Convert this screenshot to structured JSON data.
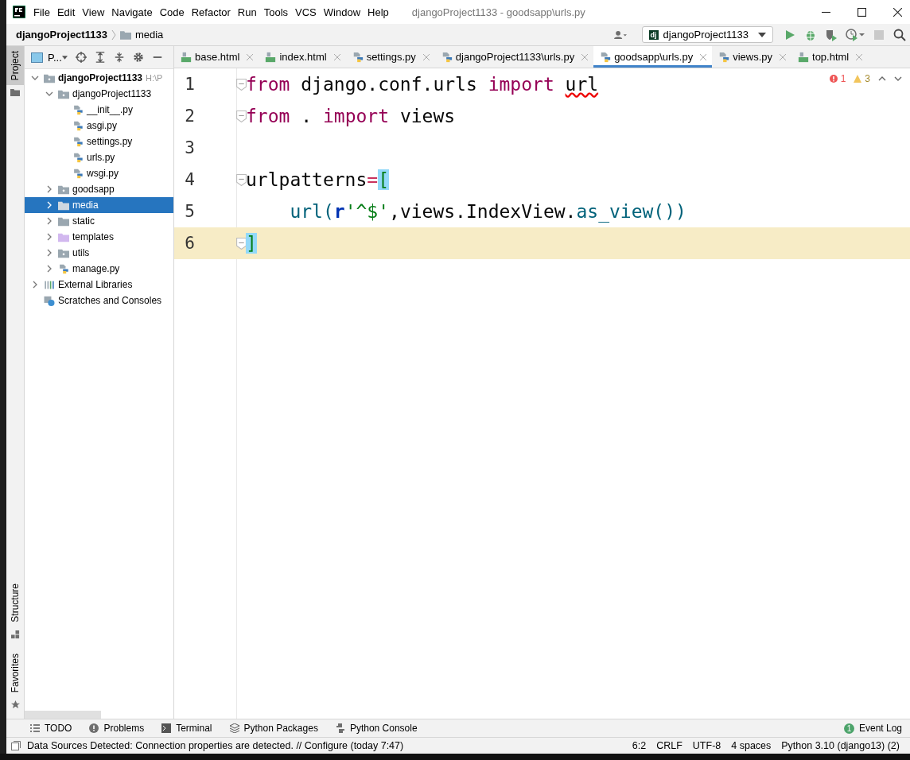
{
  "window": {
    "title": "djangoProject1133 - goodsapp\\urls.py"
  },
  "menu": [
    "File",
    "Edit",
    "View",
    "Navigate",
    "Code",
    "Refactor",
    "Run",
    "Tools",
    "VCS",
    "Window",
    "Help"
  ],
  "breadcrumb": [
    "djangoProject1133",
    "media"
  ],
  "run_config_badge": "dj",
  "run_config": "djangoProject1133",
  "left_stripe": [
    {
      "label": "Project",
      "selected": true
    }
  ],
  "left_stripe_bottom": [
    {
      "label": "Structure",
      "kind": "structure"
    },
    {
      "label": "Favorites",
      "kind": "favorites"
    }
  ],
  "project_panel": {
    "title": "P...",
    "tree": [
      {
        "label": "djangoProject1133",
        "kind": "root",
        "hint": "H:\\P",
        "expanded": true,
        "selected": false,
        "children": [
          {
            "label": "djangoProject1133",
            "kind": "package",
            "expanded": true,
            "selected": false,
            "children": [
              {
                "label": "__init__.py",
                "kind": "python",
                "selected": false
              },
              {
                "label": "asgi.py",
                "kind": "python",
                "selected": false
              },
              {
                "label": "settings.py",
                "kind": "python",
                "selected": false
              },
              {
                "label": "urls.py",
                "kind": "python",
                "selected": false
              },
              {
                "label": "wsgi.py",
                "kind": "python",
                "selected": false
              }
            ]
          },
          {
            "label": "goodsapp",
            "kind": "package",
            "expanded": false,
            "selected": false
          },
          {
            "label": "media",
            "kind": "folder",
            "expanded": false,
            "selected": true
          },
          {
            "label": "static",
            "kind": "folder",
            "expanded": false,
            "selected": false
          },
          {
            "label": "templates",
            "kind": "templates",
            "expanded": false,
            "selected": false
          },
          {
            "label": "utils",
            "kind": "package",
            "expanded": false,
            "selected": false
          },
          {
            "label": "manage.py",
            "kind": "python",
            "expanded": false,
            "selected": false
          }
        ]
      },
      {
        "label": "External Libraries",
        "kind": "libraries",
        "expanded": false,
        "selected": false
      },
      {
        "label": "Scratches and Consoles",
        "kind": "scratches",
        "selected": false
      }
    ]
  },
  "tabs": [
    {
      "label": "base.html",
      "kind": "html",
      "selected": false
    },
    {
      "label": "index.html",
      "kind": "html",
      "selected": false
    },
    {
      "label": "settings.py",
      "kind": "python",
      "selected": false
    },
    {
      "label": "djangoProject1133\\urls.py",
      "kind": "python",
      "selected": false
    },
    {
      "label": "goodsapp\\urls.py",
      "kind": "python",
      "selected": true
    },
    {
      "label": "views.py",
      "kind": "python",
      "selected": false
    },
    {
      "label": "top.html",
      "kind": "html",
      "selected": false
    }
  ],
  "inspections": {
    "errors": "1",
    "warnings": "3"
  },
  "code": [
    {
      "number": "1",
      "current": false,
      "fold": true,
      "tokens": [
        {
          "text": "from",
          "kind": "kw"
        },
        {
          "text": " django.conf.urls ",
          "kind": "plain"
        },
        {
          "text": "import ",
          "kind": "kw"
        },
        {
          "text": "url",
          "kind": "error"
        }
      ]
    },
    {
      "number": "2",
      "current": false,
      "fold": true,
      "tokens": [
        {
          "text": "from",
          "kind": "kw"
        },
        {
          "text": " . ",
          "kind": "plain"
        },
        {
          "text": "import",
          "kind": "kw"
        },
        {
          "text": " views",
          "kind": "plain"
        }
      ]
    },
    {
      "number": "3",
      "current": false,
      "fold": false
    },
    {
      "number": "4",
      "current": false,
      "fold": true,
      "tokens": [
        {
          "text": "urlpatterns",
          "kind": "plain"
        },
        {
          "text": "=",
          "kind": "op"
        },
        {
          "text": "[",
          "kind": "match"
        }
      ]
    },
    {
      "number": "5",
      "current": false,
      "fold": false,
      "tokens": [
        {
          "text": "    url(",
          "kind": "func"
        },
        {
          "text": "r",
          "kind": "prefix"
        },
        {
          "text": "'^$'",
          "kind": "str"
        },
        {
          "text": ",views.IndexView.",
          "kind": "plain"
        },
        {
          "text": "as_view())",
          "kind": "func"
        }
      ]
    },
    {
      "number": "6",
      "current": true,
      "fold": true,
      "tokens": [
        {
          "text": "]",
          "kind": "match"
        }
      ]
    }
  ],
  "tool_windows": [
    {
      "label": "TODO",
      "kind": "todo"
    },
    {
      "label": "Problems",
      "kind": "problems"
    },
    {
      "label": "Terminal",
      "kind": "terminal"
    },
    {
      "label": "Python Packages",
      "kind": "packages"
    },
    {
      "label": "Python Console",
      "kind": "console"
    }
  ],
  "event_log": {
    "count": "1",
    "label": "Event Log"
  },
  "status_bar": {
    "message": "Data Sources Detected: Connection properties are detected. // Configure (today 7:47)",
    "items": [
      "6:2",
      "CRLF",
      "UTF-8",
      "4 spaces",
      "Python 3.10 (django13) (2)"
    ]
  }
}
